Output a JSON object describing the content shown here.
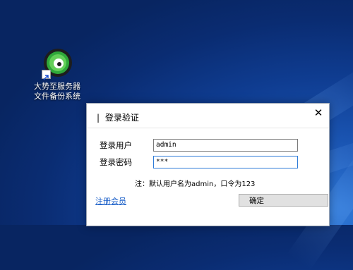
{
  "desktop": {
    "icon": {
      "line1": "大势至服务器",
      "line2": "文件备份系统"
    }
  },
  "dialog": {
    "title": "登录验证",
    "close_glyph": "✕",
    "username_label": "登录用户",
    "username_value": "admin",
    "password_label": "登录密码",
    "password_value": "***",
    "note": "注：默认用户名为admin，口令为123",
    "register_link": "注册会员",
    "ok_button": "确定"
  },
  "colors": {
    "link": "#1a5fc8",
    "focus_border": "#2d7bd8",
    "desktop_blue": "#0f3d92"
  },
  "icons": [
    "app-logo-icon",
    "shortcut-arrow-icon",
    "close-icon"
  ]
}
